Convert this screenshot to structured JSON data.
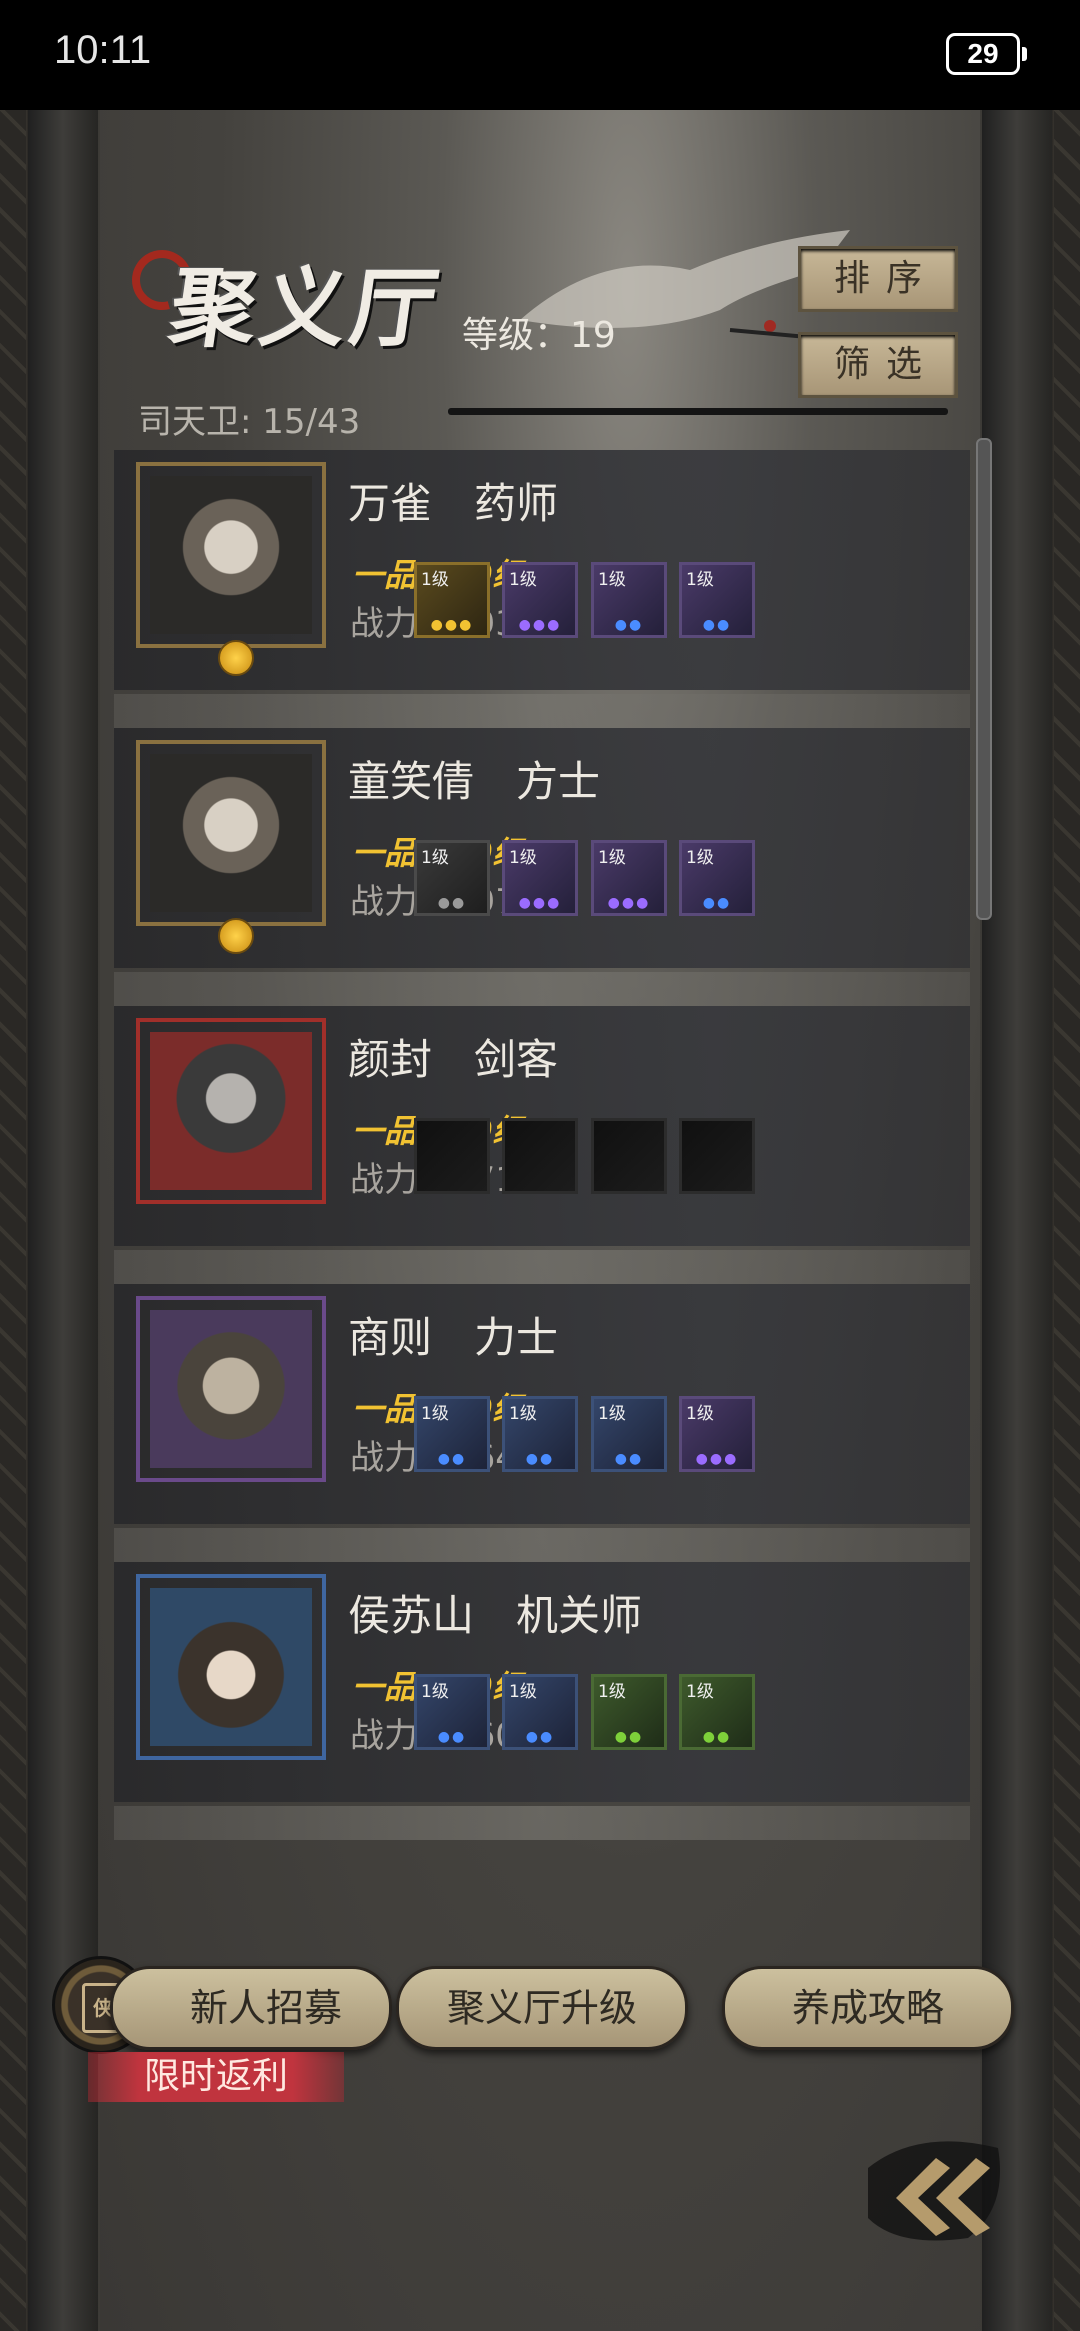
{
  "status": {
    "time": "10:11",
    "battery": "29"
  },
  "header": {
    "title": "聚义厅",
    "level_text": "等级：19",
    "guard_count": "司天卫: 15/43",
    "sort_label": "排序",
    "filter_label": "筛选"
  },
  "heroes": [
    {
      "name": "万雀　药师",
      "grade": "一品　30级",
      "power": "战力：493",
      "frame": "gold",
      "equipment": [
        {
          "level": "1级",
          "tier": "gold",
          "dots": "●●●",
          "dot_color": "#f1c232"
        },
        {
          "level": "1级",
          "tier": "purple",
          "dots": "●●●",
          "dot_color": "#9b6cff"
        },
        {
          "level": "1级",
          "tier": "purple",
          "dots": "●●",
          "dot_color": "#4a8cff"
        },
        {
          "level": "1级",
          "tier": "purple",
          "dots": "●●",
          "dot_color": "#4a8cff"
        }
      ]
    },
    {
      "name": "童笑倩　方士",
      "grade": "一品　30级",
      "power": "战力：397",
      "frame": "gold",
      "equipment": [
        {
          "level": "1级",
          "tier": "gray",
          "dots": "●●",
          "dot_color": "#9a9a9a"
        },
        {
          "level": "1级",
          "tier": "purple",
          "dots": "●●●",
          "dot_color": "#9b6cff"
        },
        {
          "level": "1级",
          "tier": "purple",
          "dots": "●●●",
          "dot_color": "#9b6cff"
        },
        {
          "level": "1级",
          "tier": "purple",
          "dots": "●●",
          "dot_color": "#4a8cff"
        }
      ]
    },
    {
      "name": "颜封　剑客",
      "grade": "一品　30级",
      "power": "战力：271",
      "frame": "red",
      "equipment": [
        {
          "level": "",
          "tier": "empty",
          "dots": "",
          "dot_color": "#000"
        },
        {
          "level": "",
          "tier": "empty",
          "dots": "",
          "dot_color": "#000"
        },
        {
          "level": "",
          "tier": "empty",
          "dots": "",
          "dot_color": "#000"
        },
        {
          "level": "",
          "tier": "empty",
          "dots": "",
          "dot_color": "#000"
        }
      ]
    },
    {
      "name": "商则　力士",
      "grade": "一品　30级",
      "power": "战力：264",
      "frame": "purple",
      "equipment": [
        {
          "level": "1级",
          "tier": "blue",
          "dots": "●●",
          "dot_color": "#4a8cff"
        },
        {
          "level": "1级",
          "tier": "blue",
          "dots": "●●",
          "dot_color": "#4a8cff"
        },
        {
          "level": "1级",
          "tier": "blue",
          "dots": "●●",
          "dot_color": "#4a8cff"
        },
        {
          "level": "1级",
          "tier": "purple",
          "dots": "●●●",
          "dot_color": "#9b6cff"
        }
      ]
    },
    {
      "name": "侯苏山　机关师",
      "grade": "一品　30级",
      "power": "战力：260",
      "frame": "blue",
      "equipment": [
        {
          "level": "1级",
          "tier": "blue",
          "dots": "●●",
          "dot_color": "#4a8cff"
        },
        {
          "level": "1级",
          "tier": "blue",
          "dots": "●●",
          "dot_color": "#4a8cff"
        },
        {
          "level": "1级",
          "tier": "green",
          "dots": "●●",
          "dot_color": "#7ed03a"
        },
        {
          "level": "1级",
          "tier": "green",
          "dots": "●●",
          "dot_color": "#7ed03a"
        }
      ]
    }
  ],
  "footer": {
    "recruit_label": "新人招募",
    "recruit_icon_glyph": "侠",
    "upgrade_label": "聚义厅升级",
    "guide_label": "养成攻略",
    "limited_label": "限时返利"
  }
}
